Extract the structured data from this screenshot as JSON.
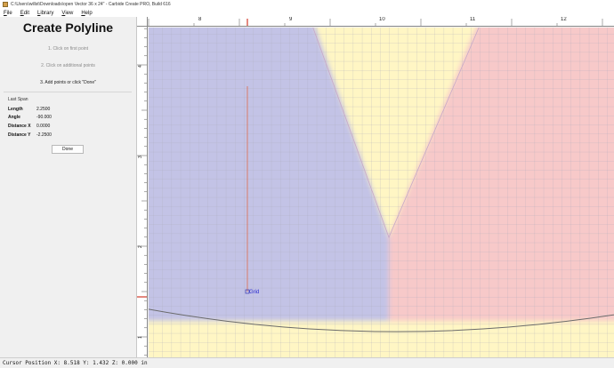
{
  "window": {
    "title": "C:\\Users\\willst\\Downloads\\open Vector 36 x 24\" - Carbide Create PRO, Build 616"
  },
  "menu": {
    "items": [
      "File",
      "Edit",
      "Library",
      "View",
      "Help"
    ]
  },
  "panel": {
    "title": "Create Polyline",
    "steps": [
      "1. Click on first point",
      "2. Click on additional points",
      "3. Add points or click \"Done\""
    ],
    "last_span_label": "Last Span",
    "properties": [
      {
        "key": "Length",
        "value": "2.2500"
      },
      {
        "key": "Angle",
        "value": "-90.000"
      },
      {
        "key": "Distance X",
        "value": "0.0000"
      },
      {
        "key": "Distance Y",
        "value": "-2.2500"
      }
    ],
    "done_label": "Done"
  },
  "rulers": {
    "x_labels": [
      "8",
      "9",
      "10",
      "11",
      "12"
    ],
    "y_labels": [
      "4",
      "3",
      "2",
      "1"
    ]
  },
  "canvas": {
    "snap_label": "Grid",
    "colors": {
      "blue_region": "#c3c3e6",
      "yellow_region": "#fff6c4",
      "pink_region": "#f7c9c9",
      "grid": "#a8a8b8",
      "polyline": "#e06a4a",
      "outline": "#6a6a6a"
    }
  },
  "status": {
    "cursor": "Cursor Position X: 8.518 Y: 1.432 Z: 0.000 in"
  }
}
